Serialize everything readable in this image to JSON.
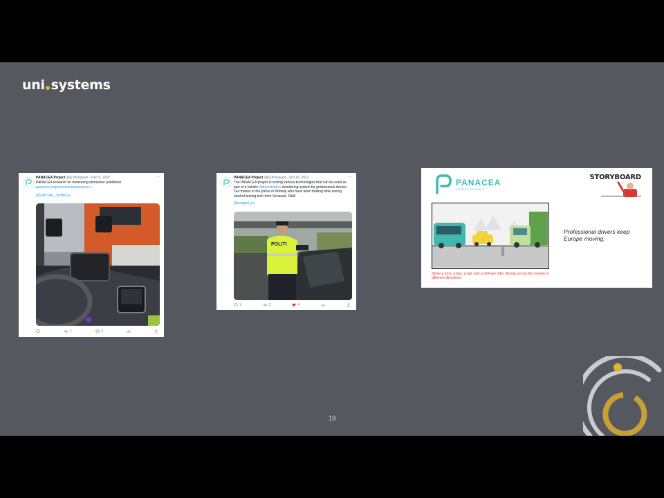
{
  "logo": {
    "left": "uni",
    "right": "systems"
  },
  "page_number": "19",
  "tweet1": {
    "name": "PANACEA Project",
    "handle_date": "@EUPanacea · Dec 5, 2022",
    "text": "PANACEA research on measuring distraction published",
    "link": "panacea-project.eu/news/panacea-r...",
    "mention": "@VIRTUAL_VEHICLE",
    "retweets": "1",
    "likes": "1"
  },
  "tweet2": {
    "name": "PANACEA Project",
    "handle_date": "@EUPanacea · Oct 26, 2022",
    "text_a": "The PANACEA project is testing various technologies that can be used as part of a holistic ",
    "hashtag": "#fitnesstodrive",
    "text_b": " monitoring system for professional drivers.  Our thanks to the police in Norway who have been trialling time-saving alcohol-testing tech from Senseair.  Takk!",
    "mention": "@roadpol_eu",
    "vest_label": "POLITI",
    "replies": "1",
    "retweets": "2",
    "likes": "4"
  },
  "storyboard": {
    "brand": "PANACEA",
    "tagline": "FITNESS TO DRIVE",
    "title": "STORYBOARD",
    "caption": "Professional drivers keep Europe moving.",
    "note": "Show a lorry, a bus, a taxi and a delivery rider driving across the screen in different directions."
  },
  "colors": {
    "slide_bg": "#55585f",
    "accent_gold": "#e3b030",
    "ring_grey": "#c9cbcf",
    "brand_teal": "#3fb8af",
    "twitter_blue": "#1d9bf0",
    "like_pink": "#e0245e",
    "note_red": "#d7322d"
  },
  "icons": [
    "panacea-logo-icon",
    "more-options-icon",
    "reply-icon",
    "retweet-icon",
    "like-icon",
    "analytics-icon",
    "share-icon"
  ]
}
